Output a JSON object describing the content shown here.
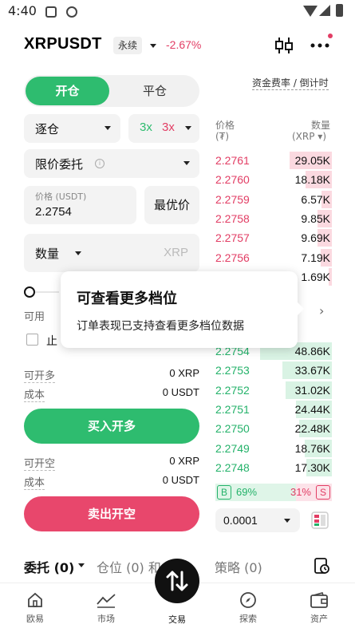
{
  "status_bar": {
    "time": "4:40"
  },
  "header": {
    "pair": "XRPUSDT",
    "contract_type": "永续",
    "change": "-2.67%",
    "icons": [
      "candlestick-chart-icon",
      "more-dots-icon"
    ]
  },
  "trade_tabs": {
    "open": "开仓",
    "close": "平仓",
    "active": "open"
  },
  "funding_link": "资金费率 / 倒计时",
  "form": {
    "margin_mode": "逐仓",
    "leverage_long": "3x",
    "leverage_short": "3x",
    "order_type": "限价委托",
    "price_label": "价格 (USDT)",
    "price_value": "2.2754",
    "best_price": "最优价",
    "qty_label": "数量",
    "qty_placeholder": "XRP",
    "slider_percent": 0,
    "available_label": "可用",
    "tpsl_label": "止"
  },
  "long_info": {
    "max_open_label": "可开多",
    "max_open_value": "0 XRP",
    "cost_label": "成本",
    "cost_value": "0 USDT",
    "button": "买入开多"
  },
  "short_info": {
    "max_open_label": "可开空",
    "max_open_value": "0 XRP",
    "cost_label": "成本",
    "cost_value": "0 USDT",
    "button": "卖出开空"
  },
  "orderbook": {
    "price_header": "价格",
    "price_unit": "(₮)",
    "qty_header": "数量",
    "qty_unit": "(XRP ▾)",
    "asks": [
      {
        "price": "2.2761",
        "qty": "29.05K",
        "depth": 0.59
      },
      {
        "price": "2.2760",
        "qty": "18.18K",
        "depth": 0.37
      },
      {
        "price": "2.2759",
        "qty": "6.57K",
        "depth": 0.14
      },
      {
        "price": "2.2758",
        "qty": "9.85K",
        "depth": 0.2
      },
      {
        "price": "2.2757",
        "qty": "9.69K",
        "depth": 0.2
      },
      {
        "price": "2.2756",
        "qty": "7.19K",
        "depth": 0.15
      },
      {
        "price": "",
        "qty": "1.69K",
        "depth": 0.04
      }
    ],
    "bids": [
      {
        "price": "2.2754",
        "qty": "48.86K",
        "depth": 1.0
      },
      {
        "price": "2.2753",
        "qty": "33.67K",
        "depth": 0.69
      },
      {
        "price": "2.2752",
        "qty": "31.02K",
        "depth": 0.64
      },
      {
        "price": "2.2751",
        "qty": "24.44K",
        "depth": 0.5
      },
      {
        "price": "2.2750",
        "qty": "22.48K",
        "depth": 0.46
      },
      {
        "price": "2.2749",
        "qty": "18.76K",
        "depth": 0.38
      },
      {
        "price": "2.2748",
        "qty": "17.30K",
        "depth": 0.36
      }
    ],
    "buy_letter": "B",
    "sell_letter": "S",
    "buy_ratio": "69%",
    "sell_ratio": "31%",
    "buy_ratio_value": 0.69,
    "precision": "0.0001"
  },
  "tooltip": {
    "title": "可查看更多档位",
    "body": "订单表现已支持查看更多档位数据"
  },
  "bottom_tabs": {
    "orders": "委托 (0)",
    "positions": "仓位 (0) 和",
    "strategy": "策略 (0)"
  },
  "nav": {
    "items": [
      "欧易",
      "市场",
      "交易",
      "探索",
      "资产"
    ],
    "active": "交易"
  },
  "colors": {
    "buy": "#2ebc6f",
    "sell": "#e8476c",
    "price_up": "#24b26a",
    "price_down": "#e23d64"
  }
}
